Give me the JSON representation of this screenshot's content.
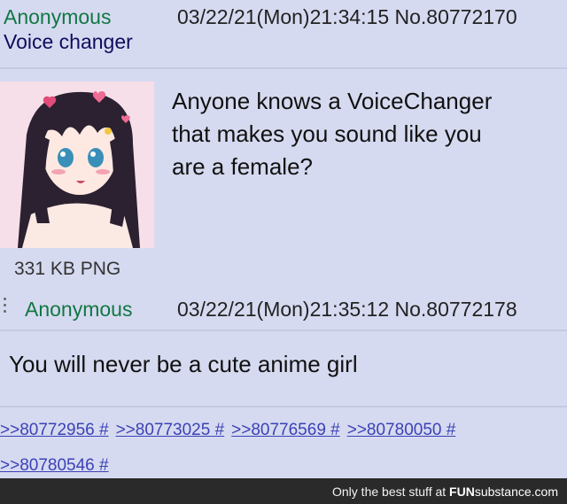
{
  "op": {
    "name": "Anonymous",
    "datetime": "03/22/21(Mon)21:34:15 No.80772170",
    "subject": "Voice changer",
    "text_lines": [
      "Anyone knows a VoiceChanger",
      "that makes you sound like you",
      "are a female?"
    ],
    "file_size": "331 KB PNG"
  },
  "reply": {
    "name": "Anonymous",
    "datetime": "03/22/21(Mon)21:35:12 No.80772178",
    "text": "You will never be a cute anime girl",
    "backlinks": [
      ">>80772956 #",
      ">>80773025 #",
      ">>80776569 #",
      ">>80780050 #",
      ">>80780546 #"
    ]
  },
  "footer": {
    "tagline": "Only the best stuff at ",
    "brand_fun": "FUN",
    "brand_sub": "substance",
    "brand_tld": ".com"
  },
  "colors": {
    "post_bg": "#d6daf0",
    "name": "#117743",
    "subject": "#0f0c5d",
    "link": "#3b42b6",
    "footer_bg": "#2a2a2a"
  }
}
